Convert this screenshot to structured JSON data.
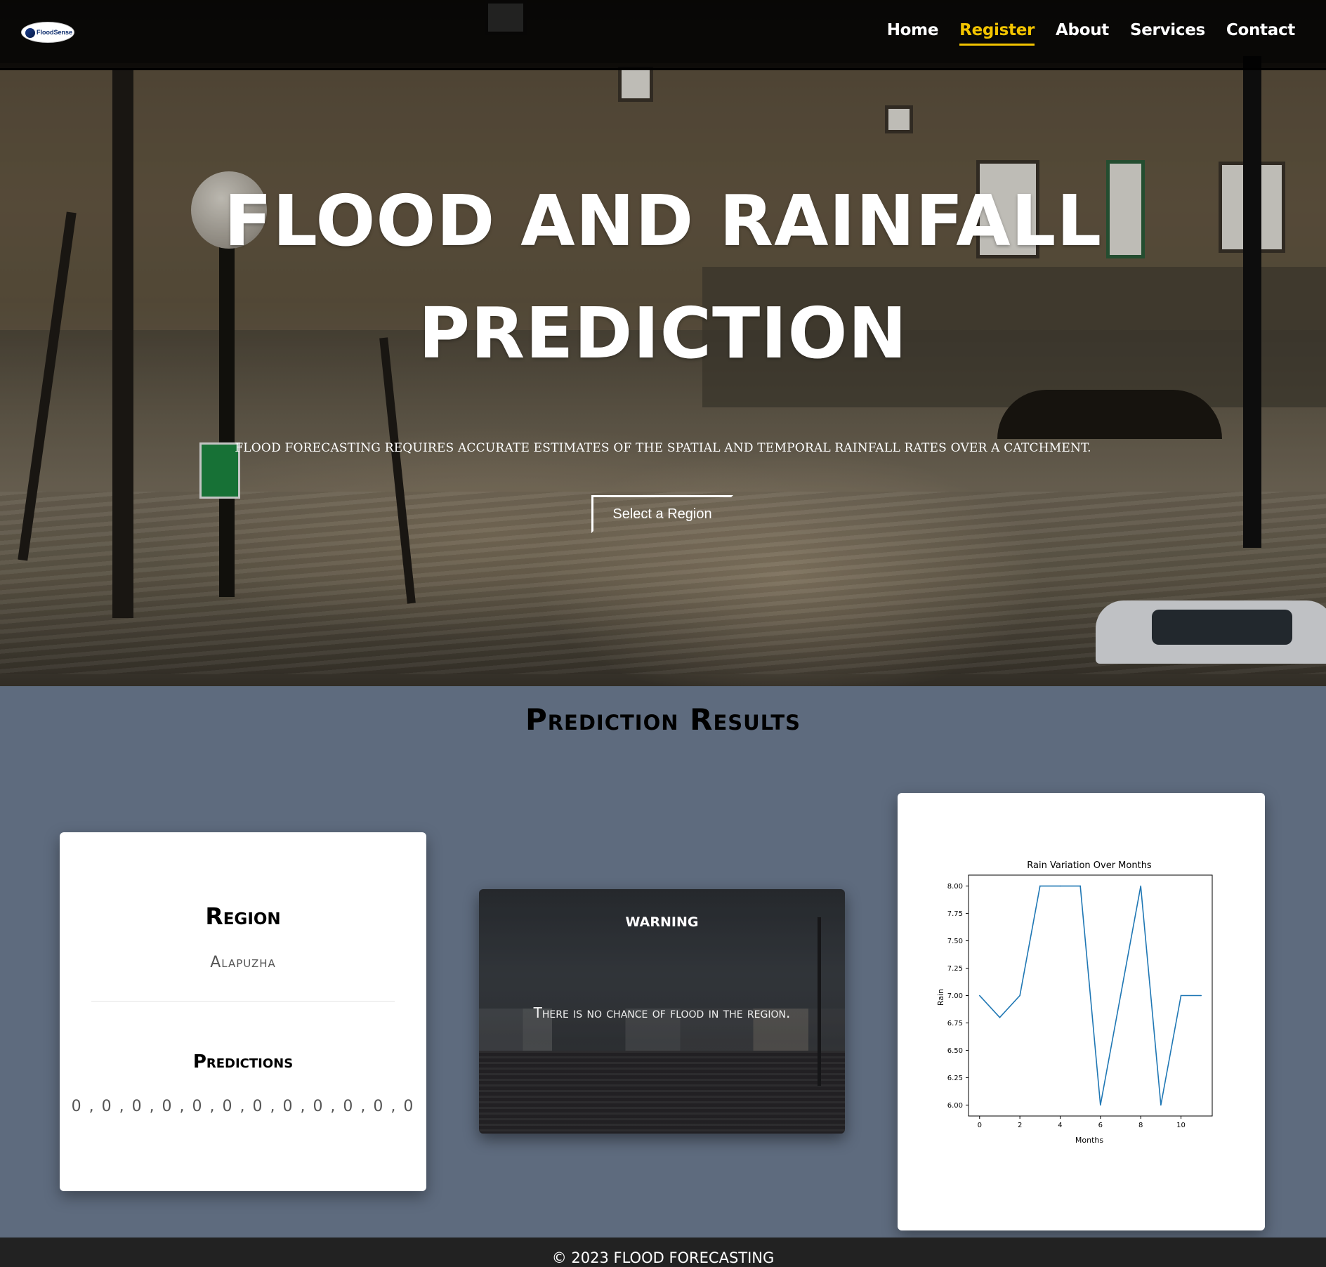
{
  "nav": {
    "logo_text": "FloodSense",
    "links": [
      {
        "label": "Home",
        "active": false
      },
      {
        "label": "Register",
        "active": true
      },
      {
        "label": "About",
        "active": false
      },
      {
        "label": "Services",
        "active": false
      },
      {
        "label": "Contact",
        "active": false
      }
    ],
    "accent_color": "#f3c400"
  },
  "hero": {
    "title_line1": "FLOOD AND RAINFALL",
    "title_line2": "PREDICTION",
    "subtitle": "FLOOD FORECASTING REQUIRES ACCURATE ESTIMATES OF THE SPATIAL AND TEMPORAL RAINFALL RATES OVER A CATCHMENT.",
    "button_label": "Select a Region"
  },
  "results": {
    "title": "Prediction Results",
    "region_card": {
      "heading": "Region",
      "region_name": "Alapuzha",
      "predictions_heading": "Predictions",
      "predictions_values": "0 , 0 , 0 , 0 , 0 , 0 , 0 , 0 , 0 , 0 , 0 , 0"
    },
    "warning_card": {
      "title": "WARNING",
      "message": "There is no chance of flood in the region."
    }
  },
  "chart_data": {
    "type": "line",
    "title": "Rain Variation Over Months",
    "xlabel": "Months",
    "ylabel": "Rain",
    "x": [
      0,
      1,
      2,
      3,
      4,
      5,
      6,
      7,
      8,
      9,
      10,
      11
    ],
    "series": [
      {
        "values": [
          7.0,
          6.8,
          7.0,
          8.0,
          8.0,
          8.0,
          6.0,
          7.0,
          8.0,
          6.0,
          7.0,
          7.0
        ]
      }
    ],
    "xlim": [
      -0.55,
      11.55
    ],
    "ylim": [
      5.9,
      8.1
    ],
    "xticks": [
      "0",
      "2",
      "4",
      "6",
      "8",
      "10"
    ],
    "yticks": [
      "6.00",
      "6.25",
      "6.50",
      "6.75",
      "7.00",
      "7.25",
      "7.50",
      "7.75",
      "8.00"
    ],
    "line_color": "#1f77b4",
    "grid": false
  },
  "footer": {
    "text": "© 2023 FLOOD FORECASTING"
  }
}
